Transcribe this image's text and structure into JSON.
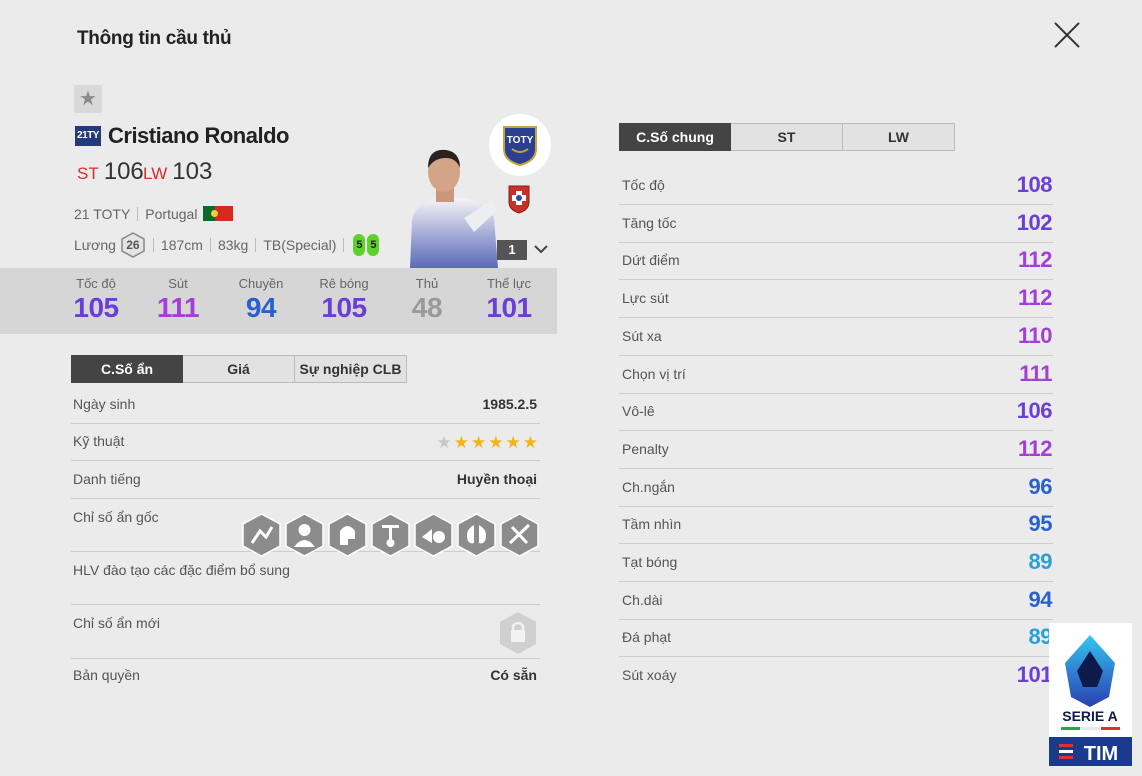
{
  "header": {
    "title": "Thông tin cầu thủ"
  },
  "player": {
    "season_badge": "21TY",
    "name": "Cristiano Ronaldo",
    "positions": [
      {
        "pos": "ST",
        "ovr": "106"
      },
      {
        "pos": "LW",
        "ovr": "103"
      }
    ],
    "season": "21 TOTY",
    "nation": "Portugal",
    "salary_label": "Lương",
    "salary": "26",
    "height": "187cm",
    "weight": "83kg",
    "body_type": "TB(Special)",
    "weak_foot_left": "5",
    "weak_foot_right": "5",
    "club_badge_text": "TOTY",
    "level": "1"
  },
  "summary_stats": [
    {
      "label": "Tốc độ",
      "value": "105",
      "color": "#6a3fd6"
    },
    {
      "label": "Sút",
      "value": "111",
      "color": "#a23fd6"
    },
    {
      "label": "Chuyền",
      "value": "94",
      "color": "#2a5fd0"
    },
    {
      "label": "Rê bóng",
      "value": "105",
      "color": "#6a3fd6"
    },
    {
      "label": "Thủ",
      "value": "48",
      "color": "#9a9a9a"
    },
    {
      "label": "Thể lực",
      "value": "101",
      "color": "#6a3fd6"
    }
  ],
  "left_tabs": [
    "C.Số ẩn",
    "Giá",
    "Sự nghiệp CLB"
  ],
  "hidden": {
    "birthday_label": "Ngày sinh",
    "birthday": "1985.2.5",
    "skill_label": "Kỹ thuật",
    "skill_stars": 5,
    "skill_max": 6,
    "fame_label": "Danh tiếng",
    "fame": "Huyền thoại",
    "traits_label": "Chỉ số ẩn gốc",
    "traits": [
      "flair-trait-icon",
      "leadership-trait-icon",
      "spartan-trait-icon",
      "target-man-trait-icon",
      "power-header-trait-icon",
      "stamina-trait-icon",
      "long-throw-trait-icon"
    ],
    "coach_label": "HLV đào tạo các đặc điểm bổ sung",
    "new_label": "Chỉ số ẩn mới",
    "rights_label": "Bản quyền",
    "rights": "Có sẵn"
  },
  "right_tabs": [
    "C.Số chung",
    "ST",
    "LW"
  ],
  "detail_stats": [
    {
      "label": "Tốc độ",
      "value": "108",
      "color": "#6a3fd6"
    },
    {
      "label": "Tăng tốc",
      "value": "102",
      "color": "#6a3fd6"
    },
    {
      "label": "Dứt điểm",
      "value": "112",
      "color": "#a23fd6"
    },
    {
      "label": "Lực sút",
      "value": "112",
      "color": "#a23fd6"
    },
    {
      "label": "Sút xa",
      "value": "110",
      "color": "#a23fd6"
    },
    {
      "label": "Chọn vị trí",
      "value": "111",
      "color": "#a23fd6"
    },
    {
      "label": "Vô-lê",
      "value": "106",
      "color": "#6a3fd6"
    },
    {
      "label": "Penalty",
      "value": "112",
      "color": "#a23fd6"
    },
    {
      "label": "Ch.ngắn",
      "value": "96",
      "color": "#2a5fd0"
    },
    {
      "label": "Tầm nhìn",
      "value": "95",
      "color": "#2a5fd0"
    },
    {
      "label": "Tạt bóng",
      "value": "89",
      "color": "#2a9fd8"
    },
    {
      "label": "Ch.dài",
      "value": "94",
      "color": "#2a5fd0"
    },
    {
      "label": "Đá phạt",
      "value": "89",
      "color": "#2a9fd8"
    },
    {
      "label": "Sút xoáy",
      "value": "101",
      "color": "#6a3fd6"
    }
  ],
  "league_logo": {
    "line1": "SERIE A",
    "line2": "TIM"
  }
}
